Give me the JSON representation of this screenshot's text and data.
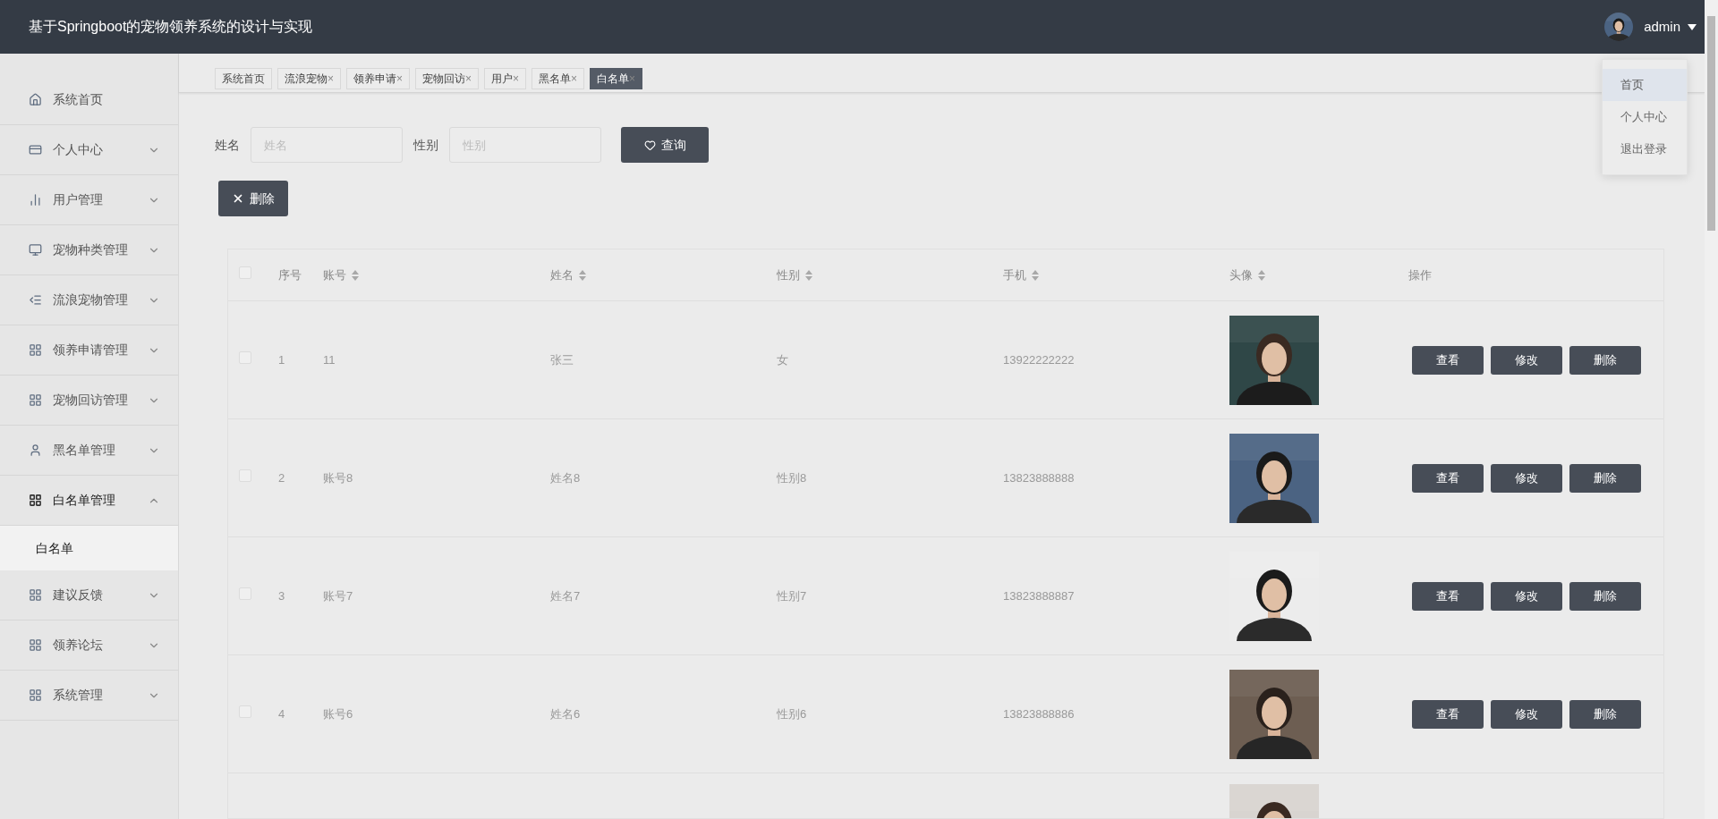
{
  "header": {
    "title": "基于Springboot的宠物领养系统的设计与实现",
    "user": "admin"
  },
  "user_menu": [
    {
      "label": "首页",
      "selected": true
    },
    {
      "label": "个人中心",
      "selected": false
    },
    {
      "label": "退出登录",
      "selected": false
    }
  ],
  "sidebar": {
    "items": [
      {
        "label": "系统首页",
        "expanded": false,
        "has_arrow": false
      },
      {
        "label": "个人中心",
        "expanded": false,
        "has_arrow": true
      },
      {
        "label": "用户管理",
        "expanded": false,
        "has_arrow": true
      },
      {
        "label": "宠物种类管理",
        "expanded": false,
        "has_arrow": true
      },
      {
        "label": "流浪宠物管理",
        "expanded": false,
        "has_arrow": true
      },
      {
        "label": "领养申请管理",
        "expanded": false,
        "has_arrow": true
      },
      {
        "label": "宠物回访管理",
        "expanded": false,
        "has_arrow": true
      },
      {
        "label": "黑名单管理",
        "expanded": false,
        "has_arrow": true
      },
      {
        "label": "白名单管理",
        "expanded": true,
        "has_arrow": true,
        "children": [
          {
            "label": "白名单",
            "selected": true
          }
        ]
      },
      {
        "label": "建议反馈",
        "expanded": false,
        "has_arrow": true
      },
      {
        "label": "领养论坛",
        "expanded": false,
        "has_arrow": true
      },
      {
        "label": "系统管理",
        "expanded": false,
        "has_arrow": true
      }
    ]
  },
  "tabs": [
    {
      "label": "系统首页",
      "selected": false
    },
    {
      "label": "流浪宠物",
      "close": "×",
      "selected": false
    },
    {
      "label": "领养申请",
      "close": "×",
      "selected": false
    },
    {
      "label": "宠物回访",
      "close": "×",
      "selected": false
    },
    {
      "label": "用户",
      "close": "×",
      "selected": false
    },
    {
      "label": "黑名单",
      "close": "×",
      "selected": false
    },
    {
      "label": "白名单",
      "close": "×",
      "selected": true
    }
  ],
  "search": {
    "fields": [
      {
        "label": "姓名",
        "placeholder": "姓名"
      },
      {
        "label": "性别",
        "placeholder": "性别"
      }
    ],
    "button": "查询"
  },
  "delete_button": "删除",
  "table": {
    "select_all_checked": false,
    "columns": [
      {
        "label": "序号",
        "sortable": false
      },
      {
        "label": "账号",
        "sortable": true
      },
      {
        "label": "姓名",
        "sortable": true
      },
      {
        "label": "性别",
        "sortable": true
      },
      {
        "label": "手机",
        "sortable": true
      },
      {
        "label": "头像",
        "sortable": true
      },
      {
        "label": "操作",
        "sortable": false
      }
    ],
    "rows": [
      {
        "kind": "full",
        "checked": false,
        "cells": [
          "1",
          "11",
          "张三",
          "女",
          "13922222222"
        ],
        "actions": [
          "查看",
          "修改",
          "删除"
        ]
      },
      {
        "kind": "full",
        "checked": false,
        "cells": [
          "2",
          "账号8",
          "姓名8",
          "性别8",
          "13823888888"
        ],
        "actions": [
          "查看",
          "修改",
          "删除"
        ]
      },
      {
        "kind": "full",
        "checked": false,
        "cells": [
          "3",
          "账号7",
          "姓名7",
          "性别7",
          "13823888887"
        ],
        "actions": [
          "查看",
          "修改",
          "删除"
        ]
      },
      {
        "kind": "full",
        "checked": false,
        "cells": [
          "4",
          "账号6",
          "姓名6",
          "性别6",
          "13823888886"
        ],
        "actions": [
          "查看",
          "修改",
          "删除"
        ]
      },
      {
        "kind": "cut"
      }
    ]
  }
}
